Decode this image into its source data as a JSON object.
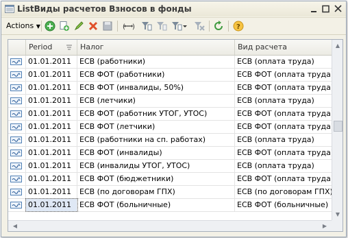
{
  "window": {
    "title": "ListВиды расчетов Взносов в фонды",
    "min_icon": "minimize-icon",
    "max_icon": "maximize-icon",
    "close_icon": "close-icon"
  },
  "toolbar": {
    "actions_label": "Actions",
    "icons": [
      "add-icon",
      "copy-icon",
      "edit-icon",
      "delete-icon",
      "save-icon",
      "hierarchy-icon",
      "filter-icon",
      "filter-settings-icon",
      "filter-dropdown-icon",
      "clear-filter-icon",
      "refresh-icon",
      "help-icon"
    ]
  },
  "table": {
    "columns": [
      "Period",
      "Налог",
      "Вид расчета"
    ],
    "rows": [
      {
        "period": "01.01.2011",
        "tax": "ЕСВ (работники)",
        "calc": "ЕСВ (оплата труда)"
      },
      {
        "period": "01.01.2011",
        "tax": "ЕСВ ФОТ (работники)",
        "calc": "ЕСВ ФОТ (оплата труда)"
      },
      {
        "period": "01.01.2011",
        "tax": "ЕСВ ФОТ (инвалиды, 50%)",
        "calc": "ЕСВ ФОТ (оплата труда)"
      },
      {
        "period": "01.01.2011",
        "tax": "ЕСВ (летчики)",
        "calc": "ЕСВ (оплата труда)"
      },
      {
        "period": "01.01.2011",
        "tax": "ЕСВ ФОТ (работник УТОГ, УТОС)",
        "calc": "ЕСВ ФОТ (оплата труда)"
      },
      {
        "period": "01.01.2011",
        "tax": "ЕСВ ФОТ (летчики)",
        "calc": "ЕСВ ФОТ (оплата труда)"
      },
      {
        "period": "01.01.2011",
        "tax": "ЕСВ (работники на сп. работах)",
        "calc": "ЕСВ (оплата труда)"
      },
      {
        "period": "01.01.2011",
        "tax": "ЕСВ ФОТ (инвалиды)",
        "calc": "ЕСВ ФОТ (оплата труда)"
      },
      {
        "period": "01.01.2011",
        "tax": "ЕСВ (инвалиды УТОГ, УТОС)",
        "calc": "ЕСВ (оплата труда)"
      },
      {
        "period": "01.01.2011",
        "tax": "ЕСВ ФОТ (бюджетники)",
        "calc": "ЕСВ ФОТ (оплата труда)"
      },
      {
        "period": "01.01.2011",
        "tax": "ЕСВ (по договорам ГПХ)",
        "calc": "ЕСВ (по договорам ГПХ)"
      },
      {
        "period": "01.01.2011",
        "tax": "ЕСВ ФОТ (больничные)",
        "calc": "ЕСВ ФОТ (больничные)"
      }
    ],
    "selected_row": 11
  }
}
